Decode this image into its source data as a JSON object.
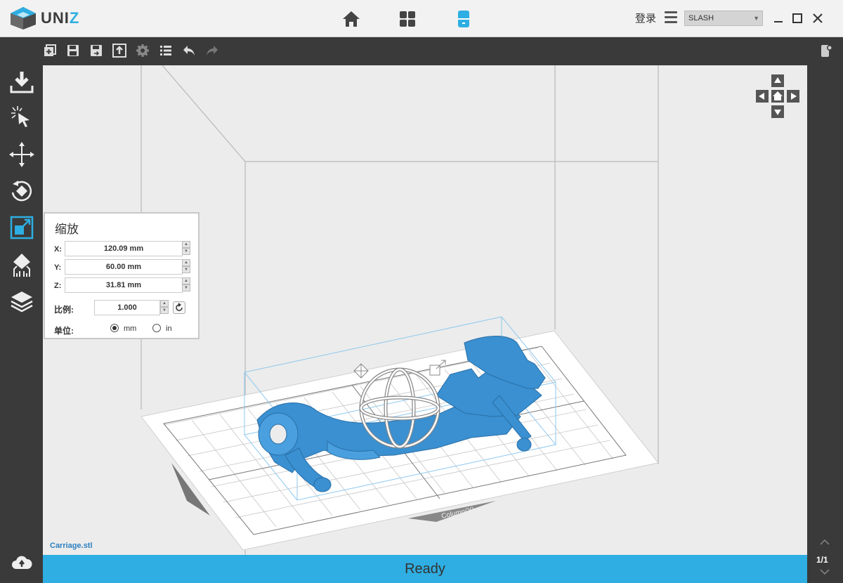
{
  "app": {
    "logo_text": "UNIZ"
  },
  "titlebar": {
    "login_label": "登录",
    "printer_value": "SLASH",
    "nav_tabs": [
      "home",
      "grid",
      "slicer"
    ]
  },
  "colors": {
    "accent": "#2eaee2",
    "model": "#3a90d0",
    "dark": "#3a3a3a"
  },
  "scale_panel": {
    "title": "缩放",
    "x_label": "X:",
    "x_value": "120.09  mm",
    "y_label": "Y:",
    "y_value": "60.00  mm",
    "z_label": "Z:",
    "z_value": "31.81  mm",
    "ratio_label": "比例:",
    "ratio_value": "1.000",
    "unit_label": "单位:",
    "unit_mm": "mm",
    "unit_in": "in",
    "unit_selected": "mm"
  },
  "viewport": {
    "filename": "Carriage.stl",
    "axis_label": "Column(Y)"
  },
  "status": {
    "text": "Ready"
  },
  "pagination": {
    "text": "1/1"
  }
}
